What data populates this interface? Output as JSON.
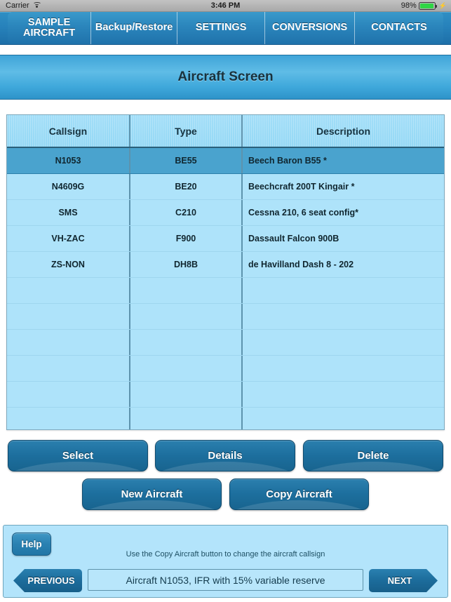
{
  "statusbar": {
    "carrier": "Carrier",
    "wifi_icon": "wifi-icon",
    "time": "3:46 PM",
    "battery_percent": "98%",
    "battery_icon": "battery-icon",
    "charging_icon": "⚡",
    "battery_level": 98,
    "battery_color": "#2fd645"
  },
  "nav": {
    "tabs": [
      {
        "label": "SAMPLE\nAIRCRAFT",
        "line1": "SAMPLE",
        "line2": "AIRCRAFT",
        "active": true
      },
      {
        "label": "Backup/Restore",
        "active": false
      },
      {
        "label": "SETTINGS",
        "active": false
      },
      {
        "label": "CONVERSIONS",
        "active": false
      },
      {
        "label": "CONTACTS",
        "active": false
      }
    ]
  },
  "header": {
    "title": "Aircraft Screen"
  },
  "table": {
    "columns": [
      "Callsign",
      "Type",
      "Description"
    ],
    "rows": [
      {
        "callsign": "N1053",
        "type": "BE55",
        "description": "Beech Baron B55 *",
        "selected": true
      },
      {
        "callsign": "N4609G",
        "type": "BE20",
        "description": "Beechcraft 200T Kingair *",
        "selected": false
      },
      {
        "callsign": "SMS",
        "type": "C210",
        "description": "Cessna 210, 6 seat config*",
        "selected": false
      },
      {
        "callsign": "VH-ZAC",
        "type": "F900",
        "description": "Dassault Falcon 900B",
        "selected": false
      },
      {
        "callsign": "ZS-NON",
        "type": "DH8B",
        "description": "de Havilland Dash 8 - 202",
        "selected": false
      }
    ],
    "empty_row_count": 6,
    "selected_row_color": "#4aa3ce",
    "row_color": "#aee3fa",
    "header_color": "#9ddcf7"
  },
  "actions": {
    "row1": [
      "Select",
      "Details",
      "Delete"
    ],
    "row2": [
      "New Aircraft",
      "Copy Aircraft"
    ]
  },
  "footer": {
    "help_label": "Help",
    "hint": "Use the Copy Aircraft button to change the aircraft callsign",
    "previous_label": "PREVIOUS",
    "next_label": "NEXT",
    "status_value": "Aircraft N1053, IFR with 15% variable reserve"
  }
}
